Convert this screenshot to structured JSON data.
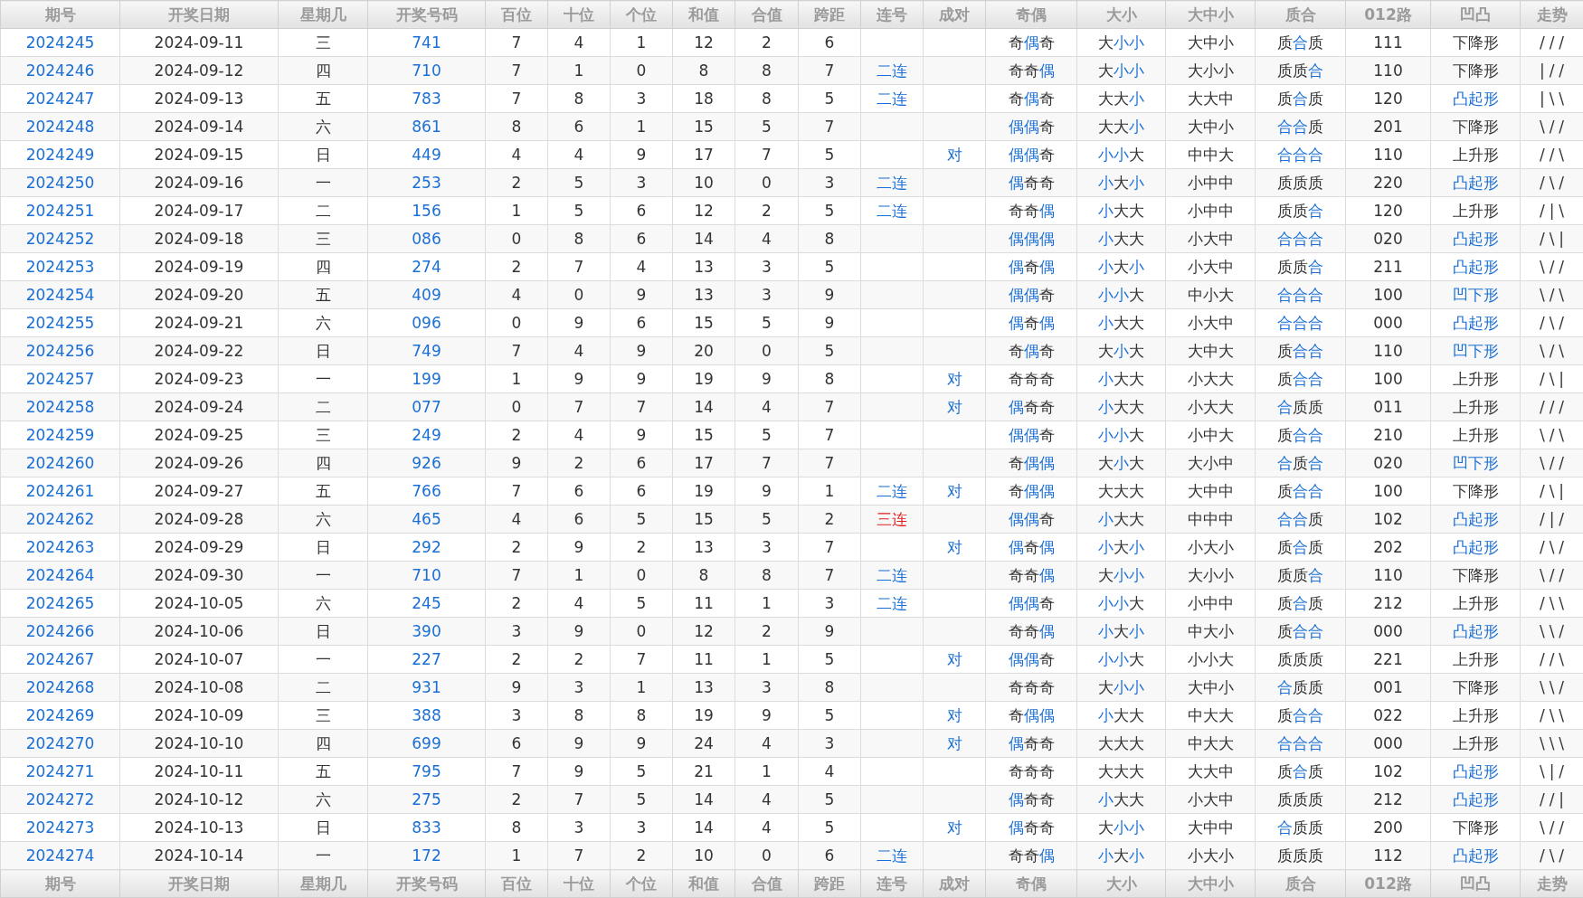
{
  "header": [
    "期号",
    "开奖日期",
    "星期几",
    "开奖号码",
    "百位",
    "十位",
    "个位",
    "和值",
    "合值",
    "跨距",
    "连号",
    "成对",
    "奇偶",
    "大小",
    "大中小",
    "质合",
    "012路",
    "凹凸",
    "走势"
  ],
  "rows": [
    {
      "period": "2024245",
      "date": "2024-09-11",
      "weekday": "三",
      "number": "741",
      "hundreds": "7",
      "tens": "4",
      "units": "1",
      "sum": "12",
      "sum_tail": "2",
      "span": "6",
      "parity": "奇偶奇",
      "parity_hl": [
        false,
        true,
        false
      ],
      "size": "大小小",
      "size_hl": [
        false,
        true,
        true
      ],
      "size3": "大中小",
      "prime": "质合质",
      "prime_hl": [
        false,
        true,
        false
      ],
      "route": "111",
      "shape": "下降形",
      "shape_hl": false,
      "trend": "///"
    },
    {
      "period": "2024246",
      "date": "2024-09-12",
      "weekday": "四",
      "number": "710",
      "hundreds": "7",
      "tens": "1",
      "units": "0",
      "sum": "8",
      "sum_tail": "8",
      "span": "7",
      "run": {
        "text": "二连",
        "color": "#1a6fd6"
      },
      "parity": "奇奇偶",
      "parity_hl": [
        false,
        false,
        true
      ],
      "size": "大小小",
      "size_hl": [
        false,
        true,
        true
      ],
      "size3": "大小小",
      "prime": "质质合",
      "prime_hl": [
        false,
        false,
        true
      ],
      "route": "110",
      "shape": "下降形",
      "shape_hl": false,
      "trend": "|//"
    },
    {
      "period": "2024247",
      "date": "2024-09-13",
      "weekday": "五",
      "number": "783",
      "hundreds": "7",
      "tens": "8",
      "units": "3",
      "sum": "18",
      "sum_tail": "8",
      "span": "5",
      "run": {
        "text": "二连",
        "color": "#1a6fd6"
      },
      "parity": "奇偶奇",
      "parity_hl": [
        false,
        true,
        false
      ],
      "size": "大大小",
      "size_hl": [
        false,
        false,
        true
      ],
      "size3": "大大中",
      "prime": "质合质",
      "prime_hl": [
        false,
        true,
        false
      ],
      "route": "120",
      "shape": "凸起形",
      "shape_hl": true,
      "trend": "|\\\\"
    },
    {
      "period": "2024248",
      "date": "2024-09-14",
      "weekday": "六",
      "number": "861",
      "hundreds": "8",
      "tens": "6",
      "units": "1",
      "sum": "15",
      "sum_tail": "5",
      "span": "7",
      "parity": "偶偶奇",
      "parity_hl": [
        true,
        true,
        false
      ],
      "size": "大大小",
      "size_hl": [
        false,
        false,
        true
      ],
      "size3": "大中小",
      "prime": "合合质",
      "prime_hl": [
        true,
        true,
        false
      ],
      "route": "201",
      "shape": "下降形",
      "shape_hl": false,
      "trend": "\\//"
    },
    {
      "period": "2024249",
      "date": "2024-09-15",
      "weekday": "日",
      "number": "449",
      "hundreds": "4",
      "tens": "4",
      "units": "9",
      "sum": "17",
      "sum_tail": "7",
      "span": "5",
      "pair": "对",
      "parity": "偶偶奇",
      "parity_hl": [
        true,
        true,
        false
      ],
      "size": "小小大",
      "size_hl": [
        true,
        true,
        false
      ],
      "size3": "中中大",
      "prime": "合合合",
      "prime_hl": [
        true,
        true,
        true
      ],
      "route": "110",
      "shape": "上升形",
      "shape_hl": false,
      "trend": "//\\"
    },
    {
      "period": "2024250",
      "date": "2024-09-16",
      "weekday": "一",
      "number": "253",
      "hundreds": "2",
      "tens": "5",
      "units": "3",
      "sum": "10",
      "sum_tail": "0",
      "span": "3",
      "run": {
        "text": "二连",
        "color": "#1a6fd6"
      },
      "parity": "偶奇奇",
      "parity_hl": [
        true,
        false,
        false
      ],
      "size": "小大小",
      "size_hl": [
        true,
        false,
        true
      ],
      "size3": "小中中",
      "prime": "质质质",
      "prime_hl": [
        false,
        false,
        false
      ],
      "route": "220",
      "shape": "凸起形",
      "shape_hl": true,
      "trend": "/\\/"
    },
    {
      "period": "2024251",
      "date": "2024-09-17",
      "weekday": "二",
      "number": "156",
      "hundreds": "1",
      "tens": "5",
      "units": "6",
      "sum": "12",
      "sum_tail": "2",
      "span": "5",
      "run": {
        "text": "二连",
        "color": "#1a6fd6"
      },
      "parity": "奇奇偶",
      "parity_hl": [
        false,
        false,
        true
      ],
      "size": "小大大",
      "size_hl": [
        true,
        false,
        false
      ],
      "size3": "小中中",
      "prime": "质质合",
      "prime_hl": [
        false,
        false,
        true
      ],
      "route": "120",
      "shape": "上升形",
      "shape_hl": false,
      "trend": "/|\\"
    },
    {
      "period": "2024252",
      "date": "2024-09-18",
      "weekday": "三",
      "number": "086",
      "hundreds": "0",
      "tens": "8",
      "units": "6",
      "sum": "14",
      "sum_tail": "4",
      "span": "8",
      "parity": "偶偶偶",
      "parity_hl": [
        true,
        true,
        true
      ],
      "size": "小大大",
      "size_hl": [
        true,
        false,
        false
      ],
      "size3": "小大中",
      "prime": "合合合",
      "prime_hl": [
        true,
        true,
        true
      ],
      "route": "020",
      "shape": "凸起形",
      "shape_hl": true,
      "trend": "/\\|"
    },
    {
      "period": "2024253",
      "date": "2024-09-19",
      "weekday": "四",
      "number": "274",
      "hundreds": "2",
      "tens": "7",
      "units": "4",
      "sum": "13",
      "sum_tail": "3",
      "span": "5",
      "parity": "偶奇偶",
      "parity_hl": [
        true,
        false,
        true
      ],
      "size": "小大小",
      "size_hl": [
        true,
        false,
        true
      ],
      "size3": "小大中",
      "prime": "质质合",
      "prime_hl": [
        false,
        false,
        true
      ],
      "route": "211",
      "shape": "凸起形",
      "shape_hl": true,
      "trend": "\\//"
    },
    {
      "period": "2024254",
      "date": "2024-09-20",
      "weekday": "五",
      "number": "409",
      "hundreds": "4",
      "tens": "0",
      "units": "9",
      "sum": "13",
      "sum_tail": "3",
      "span": "9",
      "parity": "偶偶奇",
      "parity_hl": [
        true,
        true,
        false
      ],
      "size": "小小大",
      "size_hl": [
        true,
        true,
        false
      ],
      "size3": "中小大",
      "prime": "合合合",
      "prime_hl": [
        true,
        true,
        true
      ],
      "route": "100",
      "shape": "凹下形",
      "shape_hl": true,
      "trend": "\\/\\"
    },
    {
      "period": "2024255",
      "date": "2024-09-21",
      "weekday": "六",
      "number": "096",
      "hundreds": "0",
      "tens": "9",
      "units": "6",
      "sum": "15",
      "sum_tail": "5",
      "span": "9",
      "parity": "偶奇偶",
      "parity_hl": [
        true,
        false,
        true
      ],
      "size": "小大大",
      "size_hl": [
        true,
        false,
        false
      ],
      "size3": "小大中",
      "prime": "合合合",
      "prime_hl": [
        true,
        true,
        true
      ],
      "route": "000",
      "shape": "凸起形",
      "shape_hl": true,
      "trend": "/\\/"
    },
    {
      "period": "2024256",
      "date": "2024-09-22",
      "weekday": "日",
      "number": "749",
      "hundreds": "7",
      "tens": "4",
      "units": "9",
      "sum": "20",
      "sum_tail": "0",
      "span": "5",
      "parity": "奇偶奇",
      "parity_hl": [
        false,
        true,
        false
      ],
      "size": "大小大",
      "size_hl": [
        false,
        true,
        false
      ],
      "size3": "大中大",
      "prime": "质合合",
      "prime_hl": [
        false,
        true,
        true
      ],
      "route": "110",
      "shape": "凹下形",
      "shape_hl": true,
      "trend": "\\/\\"
    },
    {
      "period": "2024257",
      "date": "2024-09-23",
      "weekday": "一",
      "number": "199",
      "hundreds": "1",
      "tens": "9",
      "units": "9",
      "sum": "19",
      "sum_tail": "9",
      "span": "8",
      "pair": "对",
      "parity": "奇奇奇",
      "parity_hl": [
        false,
        false,
        false
      ],
      "size": "小大大",
      "size_hl": [
        true,
        false,
        false
      ],
      "size3": "小大大",
      "prime": "质合合",
      "prime_hl": [
        false,
        true,
        true
      ],
      "route": "100",
      "shape": "上升形",
      "shape_hl": false,
      "trend": "/\\|"
    },
    {
      "period": "2024258",
      "date": "2024-09-24",
      "weekday": "二",
      "number": "077",
      "hundreds": "0",
      "tens": "7",
      "units": "7",
      "sum": "14",
      "sum_tail": "4",
      "span": "7",
      "pair": "对",
      "parity": "偶奇奇",
      "parity_hl": [
        true,
        false,
        false
      ],
      "size": "小大大",
      "size_hl": [
        true,
        false,
        false
      ],
      "size3": "小大大",
      "prime": "合质质",
      "prime_hl": [
        true,
        false,
        false
      ],
      "route": "011",
      "shape": "上升形",
      "shape_hl": false,
      "trend": "///"
    },
    {
      "period": "2024259",
      "date": "2024-09-25",
      "weekday": "三",
      "number": "249",
      "hundreds": "2",
      "tens": "4",
      "units": "9",
      "sum": "15",
      "sum_tail": "5",
      "span": "7",
      "parity": "偶偶奇",
      "parity_hl": [
        true,
        true,
        false
      ],
      "size": "小小大",
      "size_hl": [
        true,
        true,
        false
      ],
      "size3": "小中大",
      "prime": "质合合",
      "prime_hl": [
        false,
        true,
        true
      ],
      "route": "210",
      "shape": "上升形",
      "shape_hl": false,
      "trend": "\\/\\"
    },
    {
      "period": "2024260",
      "date": "2024-09-26",
      "weekday": "四",
      "number": "926",
      "hundreds": "9",
      "tens": "2",
      "units": "6",
      "sum": "17",
      "sum_tail": "7",
      "span": "7",
      "parity": "奇偶偶",
      "parity_hl": [
        false,
        true,
        true
      ],
      "size": "大小大",
      "size_hl": [
        false,
        true,
        false
      ],
      "size3": "大小中",
      "prime": "合质合",
      "prime_hl": [
        true,
        false,
        true
      ],
      "route": "020",
      "shape": "凹下形",
      "shape_hl": true,
      "trend": "\\//"
    },
    {
      "period": "2024261",
      "date": "2024-09-27",
      "weekday": "五",
      "number": "766",
      "hundreds": "7",
      "tens": "6",
      "units": "6",
      "sum": "19",
      "sum_tail": "9",
      "span": "1",
      "run": {
        "text": "二连",
        "color": "#1a6fd6"
      },
      "pair": "对",
      "parity": "奇偶偶",
      "parity_hl": [
        false,
        true,
        true
      ],
      "size": "大大大",
      "size_hl": [
        false,
        false,
        false
      ],
      "size3": "大中中",
      "prime": "质合合",
      "prime_hl": [
        false,
        true,
        true
      ],
      "route": "100",
      "shape": "下降形",
      "shape_hl": false,
      "trend": "/\\|"
    },
    {
      "period": "2024262",
      "date": "2024-09-28",
      "weekday": "六",
      "number": "465",
      "hundreds": "4",
      "tens": "6",
      "units": "5",
      "sum": "15",
      "sum_tail": "5",
      "span": "2",
      "run": {
        "text": "三连",
        "color": "#e02020"
      },
      "parity": "偶偶奇",
      "parity_hl": [
        true,
        true,
        false
      ],
      "size": "小大大",
      "size_hl": [
        true,
        false,
        false
      ],
      "size3": "中中中",
      "prime": "合合质",
      "prime_hl": [
        true,
        true,
        false
      ],
      "route": "102",
      "shape": "凸起形",
      "shape_hl": true,
      "trend": "/|/"
    },
    {
      "period": "2024263",
      "date": "2024-09-29",
      "weekday": "日",
      "number": "292",
      "hundreds": "2",
      "tens": "9",
      "units": "2",
      "sum": "13",
      "sum_tail": "3",
      "span": "7",
      "pair": "对",
      "parity": "偶奇偶",
      "parity_hl": [
        true,
        false,
        true
      ],
      "size": "小大小",
      "size_hl": [
        true,
        false,
        true
      ],
      "size3": "小大小",
      "prime": "质合质",
      "prime_hl": [
        false,
        true,
        false
      ],
      "route": "202",
      "shape": "凸起形",
      "shape_hl": true,
      "trend": "/\\/"
    },
    {
      "period": "2024264",
      "date": "2024-09-30",
      "weekday": "一",
      "number": "710",
      "hundreds": "7",
      "tens": "1",
      "units": "0",
      "sum": "8",
      "sum_tail": "8",
      "span": "7",
      "run": {
        "text": "二连",
        "color": "#1a6fd6"
      },
      "parity": "奇奇偶",
      "parity_hl": [
        false,
        false,
        true
      ],
      "size": "大小小",
      "size_hl": [
        false,
        true,
        true
      ],
      "size3": "大小小",
      "prime": "质质合",
      "prime_hl": [
        false,
        false,
        true
      ],
      "route": "110",
      "shape": "下降形",
      "shape_hl": false,
      "trend": "\\//"
    },
    {
      "period": "2024265",
      "date": "2024-10-05",
      "weekday": "六",
      "number": "245",
      "hundreds": "2",
      "tens": "4",
      "units": "5",
      "sum": "11",
      "sum_tail": "1",
      "span": "3",
      "run": {
        "text": "二连",
        "color": "#1a6fd6"
      },
      "parity": "偶偶奇",
      "parity_hl": [
        true,
        true,
        false
      ],
      "size": "小小大",
      "size_hl": [
        true,
        true,
        false
      ],
      "size3": "小中中",
      "prime": "质合质",
      "prime_hl": [
        false,
        true,
        false
      ],
      "route": "212",
      "shape": "上升形",
      "shape_hl": false,
      "trend": "/\\\\"
    },
    {
      "period": "2024266",
      "date": "2024-10-06",
      "weekday": "日",
      "number": "390",
      "hundreds": "3",
      "tens": "9",
      "units": "0",
      "sum": "12",
      "sum_tail": "2",
      "span": "9",
      "parity": "奇奇偶",
      "parity_hl": [
        false,
        false,
        true
      ],
      "size": "小大小",
      "size_hl": [
        true,
        false,
        true
      ],
      "size3": "中大小",
      "prime": "质合合",
      "prime_hl": [
        false,
        true,
        true
      ],
      "route": "000",
      "shape": "凸起形",
      "shape_hl": true,
      "trend": "\\\\/"
    },
    {
      "period": "2024267",
      "date": "2024-10-07",
      "weekday": "一",
      "number": "227",
      "hundreds": "2",
      "tens": "2",
      "units": "7",
      "sum": "11",
      "sum_tail": "1",
      "span": "5",
      "pair": "对",
      "parity": "偶偶奇",
      "parity_hl": [
        true,
        true,
        false
      ],
      "size": "小小大",
      "size_hl": [
        true,
        true,
        false
      ],
      "size3": "小小大",
      "prime": "质质质",
      "prime_hl": [
        false,
        false,
        false
      ],
      "route": "221",
      "shape": "上升形",
      "shape_hl": false,
      "trend": "//\\"
    },
    {
      "period": "2024268",
      "date": "2024-10-08",
      "weekday": "二",
      "number": "931",
      "hundreds": "9",
      "tens": "3",
      "units": "1",
      "sum": "13",
      "sum_tail": "3",
      "span": "8",
      "parity": "奇奇奇",
      "parity_hl": [
        false,
        false,
        false
      ],
      "size": "大小小",
      "size_hl": [
        false,
        true,
        true
      ],
      "size3": "大中小",
      "prime": "合质质",
      "prime_hl": [
        true,
        false,
        false
      ],
      "route": "001",
      "shape": "下降形",
      "shape_hl": false,
      "trend": "\\\\/"
    },
    {
      "period": "2024269",
      "date": "2024-10-09",
      "weekday": "三",
      "number": "388",
      "hundreds": "3",
      "tens": "8",
      "units": "8",
      "sum": "19",
      "sum_tail": "9",
      "span": "5",
      "pair": "对",
      "parity": "奇偶偶",
      "parity_hl": [
        false,
        true,
        true
      ],
      "size": "小大大",
      "size_hl": [
        true,
        false,
        false
      ],
      "size3": "中大大",
      "prime": "质合合",
      "prime_hl": [
        false,
        true,
        true
      ],
      "route": "022",
      "shape": "上升形",
      "shape_hl": false,
      "trend": "/\\\\"
    },
    {
      "period": "2024270",
      "date": "2024-10-10",
      "weekday": "四",
      "number": "699",
      "hundreds": "6",
      "tens": "9",
      "units": "9",
      "sum": "24",
      "sum_tail": "4",
      "span": "3",
      "pair": "对",
      "parity": "偶奇奇",
      "parity_hl": [
        true,
        false,
        false
      ],
      "size": "大大大",
      "size_hl": [
        false,
        false,
        false
      ],
      "size3": "中大大",
      "prime": "合合合",
      "prime_hl": [
        true,
        true,
        true
      ],
      "route": "000",
      "shape": "上升形",
      "shape_hl": false,
      "trend": "\\\\\\"
    },
    {
      "period": "2024271",
      "date": "2024-10-11",
      "weekday": "五",
      "number": "795",
      "hundreds": "7",
      "tens": "9",
      "units": "5",
      "sum": "21",
      "sum_tail": "1",
      "span": "4",
      "parity": "奇奇奇",
      "parity_hl": [
        false,
        false,
        false
      ],
      "size": "大大大",
      "size_hl": [
        false,
        false,
        false
      ],
      "size3": "大大中",
      "prime": "质合质",
      "prime_hl": [
        false,
        true,
        false
      ],
      "route": "102",
      "shape": "凸起形",
      "shape_hl": true,
      "trend": "\\|/"
    },
    {
      "period": "2024272",
      "date": "2024-10-12",
      "weekday": "六",
      "number": "275",
      "hundreds": "2",
      "tens": "7",
      "units": "5",
      "sum": "14",
      "sum_tail": "4",
      "span": "5",
      "parity": "偶奇奇",
      "parity_hl": [
        true,
        false,
        false
      ],
      "size": "小大大",
      "size_hl": [
        true,
        false,
        false
      ],
      "size3": "小大中",
      "prime": "质质质",
      "prime_hl": [
        false,
        false,
        false
      ],
      "route": "212",
      "shape": "凸起形",
      "shape_hl": true,
      "trend": "//|"
    },
    {
      "period": "2024273",
      "date": "2024-10-13",
      "weekday": "日",
      "number": "833",
      "hundreds": "8",
      "tens": "3",
      "units": "3",
      "sum": "14",
      "sum_tail": "4",
      "span": "5",
      "pair": "对",
      "parity": "偶奇奇",
      "parity_hl": [
        true,
        false,
        false
      ],
      "size": "大小小",
      "size_hl": [
        false,
        true,
        true
      ],
      "size3": "大中中",
      "prime": "合质质",
      "prime_hl": [
        true,
        false,
        false
      ],
      "route": "200",
      "shape": "下降形",
      "shape_hl": false,
      "trend": "\\//"
    },
    {
      "period": "2024274",
      "date": "2024-10-14",
      "weekday": "一",
      "number": "172",
      "hundreds": "1",
      "tens": "7",
      "units": "2",
      "sum": "10",
      "sum_tail": "0",
      "span": "6",
      "run": {
        "text": "二连",
        "color": "#1a6fd6"
      },
      "parity": "奇奇偶",
      "parity_hl": [
        false,
        false,
        true
      ],
      "size": "小大小",
      "size_hl": [
        true,
        false,
        true
      ],
      "size3": "小大小",
      "prime": "质质质",
      "prime_hl": [
        false,
        false,
        false
      ],
      "route": "112",
      "shape": "凸起形",
      "shape_hl": true,
      "trend": "/\\/"
    }
  ],
  "footer": [
    "期号",
    "开奖日期",
    "星期几",
    "开奖号码",
    "百位",
    "十位",
    "个位",
    "和值",
    "合值",
    "跨距",
    "连号",
    "成对",
    "奇偶",
    "大小",
    "大中小",
    "质合",
    "012路",
    "凹凸",
    "走势"
  ]
}
